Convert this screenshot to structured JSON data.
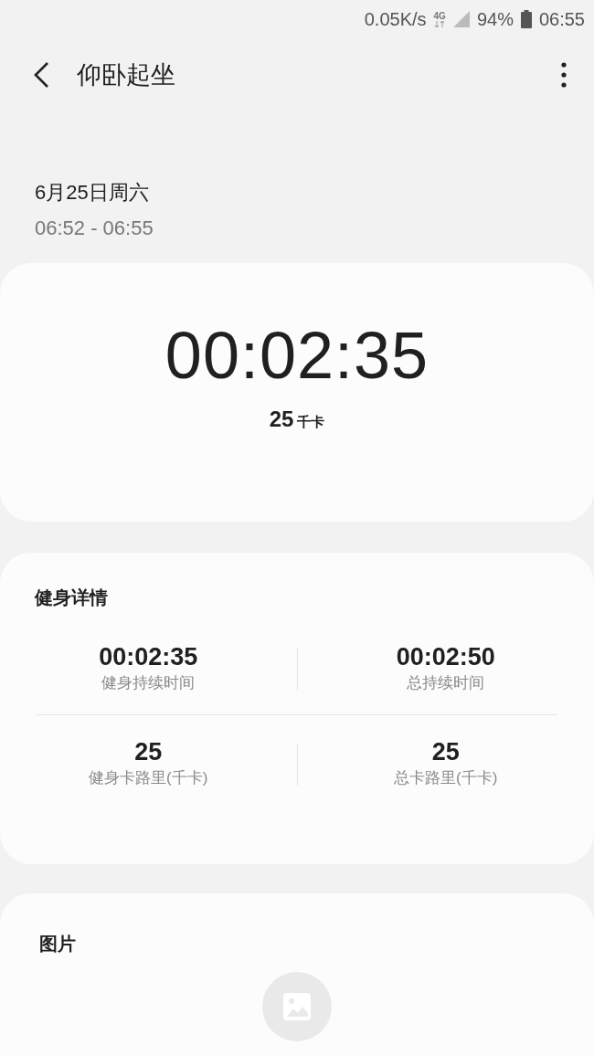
{
  "status_bar": {
    "network_speed": "0.05K/s",
    "network_type": "4G",
    "battery": "94%",
    "time": "06:55"
  },
  "header": {
    "title": "仰卧起坐"
  },
  "session": {
    "date": "6月25日周六",
    "time_range": "06:52 - 06:55"
  },
  "summary": {
    "duration": "00:02:35",
    "calories": "25",
    "calories_unit": "千卡"
  },
  "details": {
    "title": "健身详情",
    "stats": [
      {
        "value": "00:02:35",
        "label": "健身持续时间"
      },
      {
        "value": "00:02:50",
        "label": "总持续时间"
      },
      {
        "value": "25",
        "label": "健身卡路里(千卡)"
      },
      {
        "value": "25",
        "label": "总卡路里(千卡)"
      }
    ]
  },
  "pictures": {
    "title": "图片"
  }
}
